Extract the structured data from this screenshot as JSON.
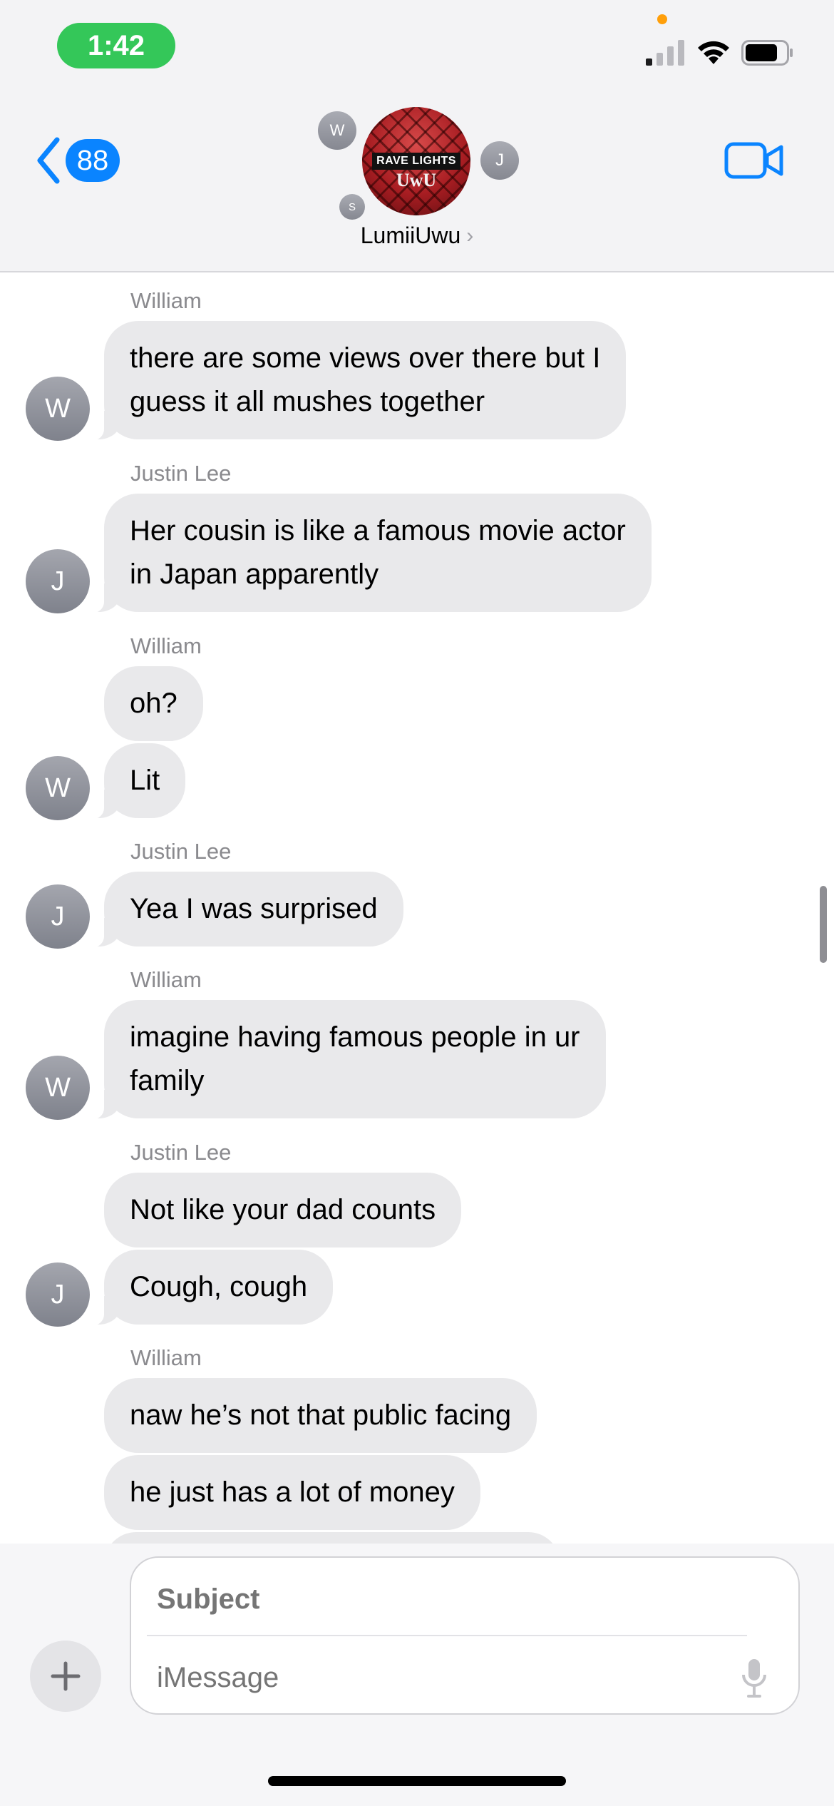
{
  "status_bar": {
    "time": "1:42",
    "signal_icon": "cellular-signal-icon",
    "wifi_icon": "wifi-icon",
    "battery_icon": "battery-icon",
    "accent_colors": {
      "time_pill": "#34c759",
      "privacy_dot": "#ff9f0a"
    }
  },
  "header": {
    "back_badge": "88",
    "group_name": "LumiiUwu",
    "group_avatar": {
      "banner": "RAVE LIGHTS",
      "sub": "UwU"
    },
    "members": [
      "W",
      "J",
      "S"
    ],
    "video_icon": "video-camera-icon",
    "accent": "#0a84ff"
  },
  "messages": [
    {
      "sender": "William",
      "initial": "W",
      "texts": [
        "there are some views over there but I\nguess it all mushes together"
      ]
    },
    {
      "sender": "Justin Lee",
      "initial": "J",
      "texts": [
        "Her cousin is like a famous movie actor\nin Japan apparently"
      ]
    },
    {
      "sender": "William",
      "initial": "W",
      "texts": [
        "oh?",
        "Lit"
      ]
    },
    {
      "sender": "Justin Lee",
      "initial": "J",
      "texts": [
        "Yea I was surprised"
      ]
    },
    {
      "sender": "William",
      "initial": "W",
      "texts": [
        "imagine having famous people in ur\nfamily"
      ]
    },
    {
      "sender": "Justin Lee",
      "initial": "J",
      "texts": [
        "Not like your dad counts",
        "Cough, cough"
      ]
    },
    {
      "sender": "William",
      "initial": "W",
      "texts": [
        "naw he’s not that public facing",
        "he just has a lot of money"
      ]
    }
  ],
  "composer": {
    "subject_placeholder": "Subject",
    "message_placeholder": "iMessage",
    "plus_icon": "plus-icon",
    "mic_icon": "microphone-icon"
  }
}
